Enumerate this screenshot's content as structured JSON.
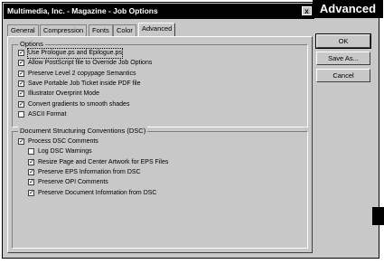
{
  "window": {
    "title": "Multimedia, Inc. - Magazine - Job Options",
    "close_glyph": "x"
  },
  "banner": {
    "label": "Advanced"
  },
  "tabs": [
    {
      "label": "General",
      "active": false
    },
    {
      "label": "Compression",
      "active": false
    },
    {
      "label": "Fonts",
      "active": false
    },
    {
      "label": "Color",
      "active": false
    },
    {
      "label": "Advanced",
      "active": true
    }
  ],
  "options_group": {
    "legend": "Options",
    "items": [
      {
        "label": "Use Prologue.ps and Epilogue.ps",
        "checked": true
      },
      {
        "label": "Allow PostScript file to Override Job Options",
        "checked": true
      },
      {
        "label": "Preserve Level 2 copypage Semantics",
        "checked": true
      },
      {
        "label": "Save Portable Job Ticket inside PDF file",
        "checked": true
      },
      {
        "label": "Illustrator Overprint Mode",
        "checked": true
      },
      {
        "label": "Convert gradients to smooth shades",
        "checked": true
      },
      {
        "label": "ASCII Format",
        "checked": false
      }
    ]
  },
  "dsc_group": {
    "legend": "Document Structuring Conventions (DSC)",
    "items": [
      {
        "label": "Process DSC Comments",
        "checked": true,
        "indent": 0
      },
      {
        "label": "Log DSC Warnings",
        "checked": false,
        "indent": 1
      },
      {
        "label": "Resize Page and Center Artwork for EPS Files",
        "checked": true,
        "indent": 1
      },
      {
        "label": "Preserve EPS Information from DSC",
        "checked": true,
        "indent": 1
      },
      {
        "label": "Preserve OPI Comments",
        "checked": true,
        "indent": 1
      },
      {
        "label": "Preserve Document Information from DSC",
        "checked": true,
        "indent": 1
      }
    ]
  },
  "buttons": {
    "ok": "OK",
    "save_as": "Save As...",
    "cancel": "Cancel"
  },
  "check_glyph": "✓"
}
